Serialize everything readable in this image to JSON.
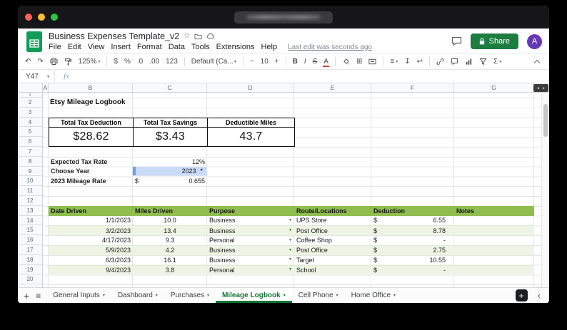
{
  "icons": {
    "undo": "↶",
    "redo": "↷",
    "caret": "▾",
    "caret_small": "▼",
    "star": "☆",
    "borders": "⊞",
    "align": "≡",
    "valign": "↧",
    "wrap": "↩",
    "sigma": "Σ",
    "minus": "−",
    "plus": "+",
    "menu": "≡",
    "chevron_left": "‹",
    "left_arrow": "◄",
    "right_arrow": "►"
  },
  "header": {
    "title": "Business Expenses Template_v2",
    "menu_items": [
      "File",
      "Edit",
      "View",
      "Insert",
      "Format",
      "Data",
      "Tools",
      "Extensions",
      "Help"
    ],
    "last_edit": "Last edit was seconds ago",
    "share_label": "Share",
    "avatar_letter": "A"
  },
  "toolbar": {
    "zoom": "125%",
    "currency": "$",
    "percent": "%",
    "dec_decimal": ".0",
    "inc_decimal": ".00",
    "more_formats": "123",
    "font_name": "Default (Ca...",
    "font_size": "10",
    "bold": "B",
    "italic": "I",
    "strike": "S",
    "text_color": "A"
  },
  "formula_bar": {
    "name_box": "Y47",
    "fx_label": "fx"
  },
  "grid": {
    "column_letters": [
      "A",
      "B",
      "C",
      "D",
      "E",
      "F",
      "G"
    ],
    "row_numbers": [
      "1",
      "2",
      "3",
      "4",
      "5",
      "6",
      "7",
      "8",
      "9",
      "10",
      "11",
      "12",
      "13",
      "14",
      "15",
      "16",
      "17",
      "18",
      "19",
      "20"
    ],
    "sheet_title": "Etsy Mileage Logbook",
    "summary_cards": [
      {
        "label": "Total Tax Deduction",
        "value": "$28.62"
      },
      {
        "label": "Total Tax Savings",
        "value": "$3.43"
      },
      {
        "label": "Deductible Miles",
        "value": "43.7"
      }
    ],
    "settings": {
      "tax_rate_label": "Expected Tax Rate",
      "tax_rate_value": "12%",
      "year_label": "Choose Year",
      "year_value": "2023",
      "mileage_label": "2023 Mileage Rate",
      "mileage_currency": "$",
      "mileage_value": "0.655"
    },
    "log_table": {
      "headers": [
        "Date Driven",
        "Miles Driven",
        "Purpose",
        "Route/Locations",
        "Deduction",
        "Notes"
      ],
      "rows": [
        {
          "date": "1/1/2023",
          "miles": "10.0",
          "purpose": "Business",
          "route": "UPS Store",
          "cur": "$",
          "amount": "6.55"
        },
        {
          "date": "3/2/2023",
          "miles": "13.4",
          "purpose": "Business",
          "route": "Post Office",
          "cur": "$",
          "amount": "8.78"
        },
        {
          "date": "4/17/2023",
          "miles": "9.3",
          "purpose": "Personal",
          "route": "Coffee Shop",
          "cur": "$",
          "amount": "-"
        },
        {
          "date": "5/9/2023",
          "miles": "4.2",
          "purpose": "Business",
          "route": "Post Office",
          "cur": "$",
          "amount": "2.75"
        },
        {
          "date": "6/3/2023",
          "miles": "16.1",
          "purpose": "Business",
          "route": "Target",
          "cur": "$",
          "amount": "10.55"
        },
        {
          "date": "9/4/2023",
          "miles": "3.8",
          "purpose": "Personal",
          "route": "School",
          "cur": "$",
          "amount": "-"
        }
      ]
    }
  },
  "tabs": {
    "items": [
      {
        "label": "General Inputs",
        "active": false
      },
      {
        "label": "Dashboard",
        "active": false
      },
      {
        "label": "Purchases",
        "active": false
      },
      {
        "label": "Mileage Logbook",
        "active": true
      },
      {
        "label": "Cell Phone",
        "active": false
      },
      {
        "label": "Home Office",
        "active": false
      }
    ]
  },
  "colors": {
    "sheets_green": "#0f9d58",
    "share_green": "#1d7c3f",
    "table_header_green": "#8fbe4f",
    "band_green": "#edf4e3",
    "year_cell_blue": "#c9daf8",
    "active_tab_green": "#137333",
    "avatar_purple": "#6638b6",
    "summary_border": "#111111"
  }
}
